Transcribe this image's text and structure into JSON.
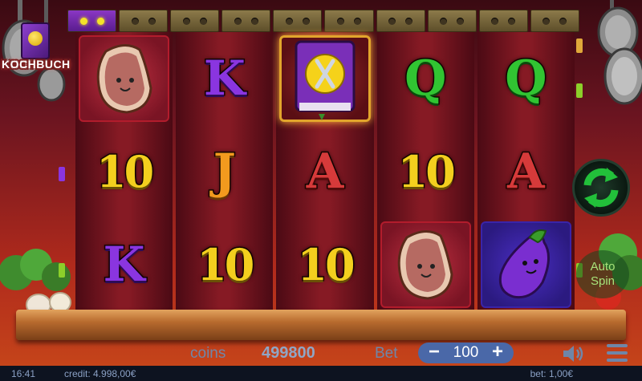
{
  "logo": {
    "text": "KOCHBUCH"
  },
  "payline_indicator": {
    "segments": 10,
    "active_index": 0
  },
  "reels": [
    [
      {
        "symbol": "steak",
        "icon": "steak-icon"
      },
      {
        "symbol": "10"
      },
      {
        "symbol": "K"
      }
    ],
    [
      {
        "symbol": "K"
      },
      {
        "symbol": "J"
      },
      {
        "symbol": "10"
      }
    ],
    [
      {
        "symbol": "cookbook",
        "icon": "cookbook-icon"
      },
      {
        "symbol": "A"
      },
      {
        "symbol": "10"
      }
    ],
    [
      {
        "symbol": "Q"
      },
      {
        "symbol": "10"
      },
      {
        "symbol": "steak",
        "icon": "steak-icon"
      }
    ],
    [
      {
        "symbol": "Q"
      },
      {
        "symbol": "A"
      },
      {
        "symbol": "eggplant",
        "icon": "eggplant-icon"
      }
    ]
  ],
  "controls": {
    "coins_label": "coins",
    "coins_value": "499800",
    "bet_label": "Bet",
    "bet_value": "100",
    "bet_minus": "−",
    "bet_plus": "+",
    "autospin_label_1": "Auto",
    "autospin_label_2": "Spin"
  },
  "status_bar": {
    "time": "16:41",
    "credit": "credit: 4.998,00€",
    "bet": "bet: 1,00€"
  },
  "colors": {
    "accent_green": "#22c03a",
    "bet_blue": "#4a68a8",
    "frame_gold": "#e2a52c"
  }
}
